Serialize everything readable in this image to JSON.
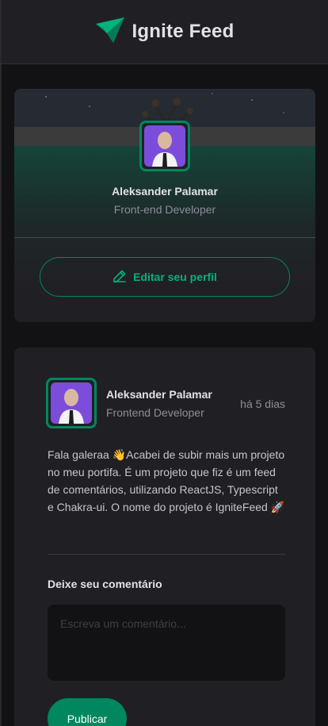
{
  "header": {
    "title": "Ignite Feed",
    "logo_icon": "ignite-logo-icon"
  },
  "profile": {
    "name": "Aleksander Palamar",
    "role": "Front-end Developer",
    "edit_label": "Editar seu perfil",
    "edit_icon": "pencil-icon"
  },
  "post": {
    "author_name": "Aleksander Palamar",
    "author_role": "Frontend Developer",
    "time": "há 5 dias",
    "content": "Fala galeraa 👋Acabei de subir mais um projeto no meu portifa. É um projeto que fiz é um feed de comentários, utilizando ReactJS, Typescript e Chakra-ui. O nome do projeto é IgniteFeed 🚀",
    "comment_label": "Deixe seu comentário",
    "comment_placeholder": "Escreva um comentário...",
    "publish_label": "Publicar"
  },
  "colors": {
    "accent": "#00875f",
    "accent_light": "#00b37e",
    "background": "#121214",
    "card": "#202024"
  }
}
